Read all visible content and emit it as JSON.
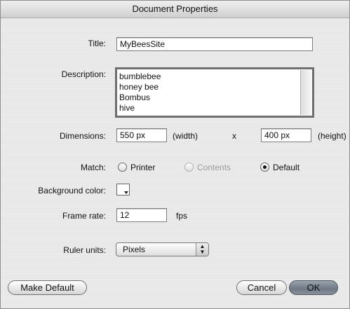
{
  "window": {
    "title": "Document Properties"
  },
  "fields": {
    "title_label": "Title:",
    "title_value": "MyBeesSite",
    "description_label": "Description:",
    "description_lines": [
      "bumblebee",
      "honey bee",
      "Bombus",
      "hive"
    ],
    "dimensions_label": "Dimensions:",
    "width_value": "550 px",
    "width_suffix": "(width)",
    "times": "x",
    "height_value": "400 px",
    "height_suffix": "(height)",
    "match_label": "Match:",
    "match_options": [
      {
        "label": "Printer",
        "selected": false,
        "enabled": true
      },
      {
        "label": "Contents",
        "selected": false,
        "enabled": false
      },
      {
        "label": "Default",
        "selected": true,
        "enabled": true
      }
    ],
    "background_label": "Background color:",
    "background_color": "#ffffff",
    "frame_rate_label": "Frame rate:",
    "frame_rate_value": "12",
    "frame_rate_unit": "fps",
    "ruler_label": "Ruler units:",
    "ruler_value": "Pixels"
  },
  "buttons": {
    "make_default": "Make Default",
    "cancel": "Cancel",
    "ok": "OK"
  }
}
